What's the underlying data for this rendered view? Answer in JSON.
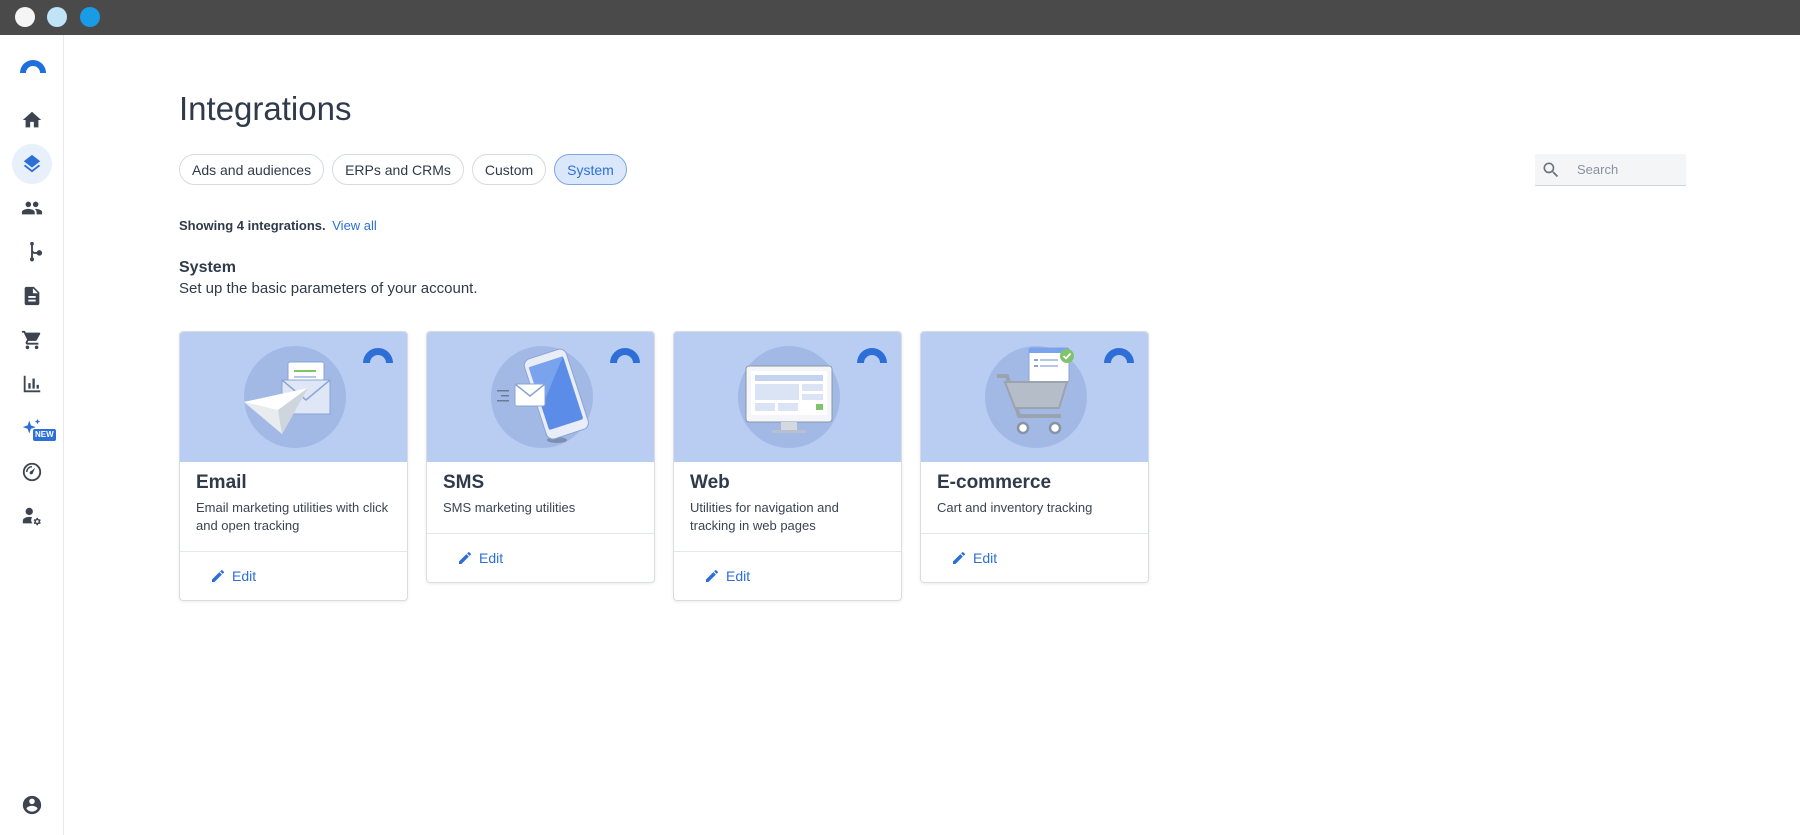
{
  "window": {
    "dots": [
      "close",
      "minimize",
      "maximize"
    ]
  },
  "sidebar": {
    "items": [
      {
        "icon": "home-icon"
      },
      {
        "icon": "layers-icon",
        "active": true
      },
      {
        "icon": "people-icon"
      },
      {
        "icon": "fork-icon"
      },
      {
        "icon": "document-icon"
      },
      {
        "icon": "cart-icon"
      },
      {
        "icon": "bar-chart-icon"
      },
      {
        "icon": "sparkle-icon",
        "badge": "NEW"
      },
      {
        "icon": "gauge-icon"
      },
      {
        "icon": "user-settings-icon"
      }
    ],
    "account_icon": "account-circle-icon"
  },
  "page": {
    "title": "Integrations"
  },
  "tabs": [
    {
      "label": "Ads and audiences",
      "active": false
    },
    {
      "label": "ERPs and CRMs",
      "active": false
    },
    {
      "label": "Custom",
      "active": false
    },
    {
      "label": "System",
      "active": true
    }
  ],
  "search": {
    "placeholder": "Search",
    "value": ""
  },
  "summary": {
    "text": "Showing 4 integrations.",
    "link": "View all"
  },
  "section": {
    "title": "System",
    "description": "Set up the basic parameters of your account."
  },
  "cards": [
    {
      "name": "Email",
      "description": "Email marketing utilities with click and open tracking",
      "action": "Edit"
    },
    {
      "name": "SMS",
      "description": "SMS marketing utilities",
      "action": "Edit"
    },
    {
      "name": "Web",
      "description": "Utilities for navigation and tracking in web pages",
      "action": "Edit"
    },
    {
      "name": "E-commerce",
      "description": "Cart and inventory tracking",
      "action": "Edit"
    }
  ],
  "colors": {
    "accent": "#2d6fd6",
    "hero": "#b9cdf2",
    "titlebar": "#4a4a4a"
  }
}
